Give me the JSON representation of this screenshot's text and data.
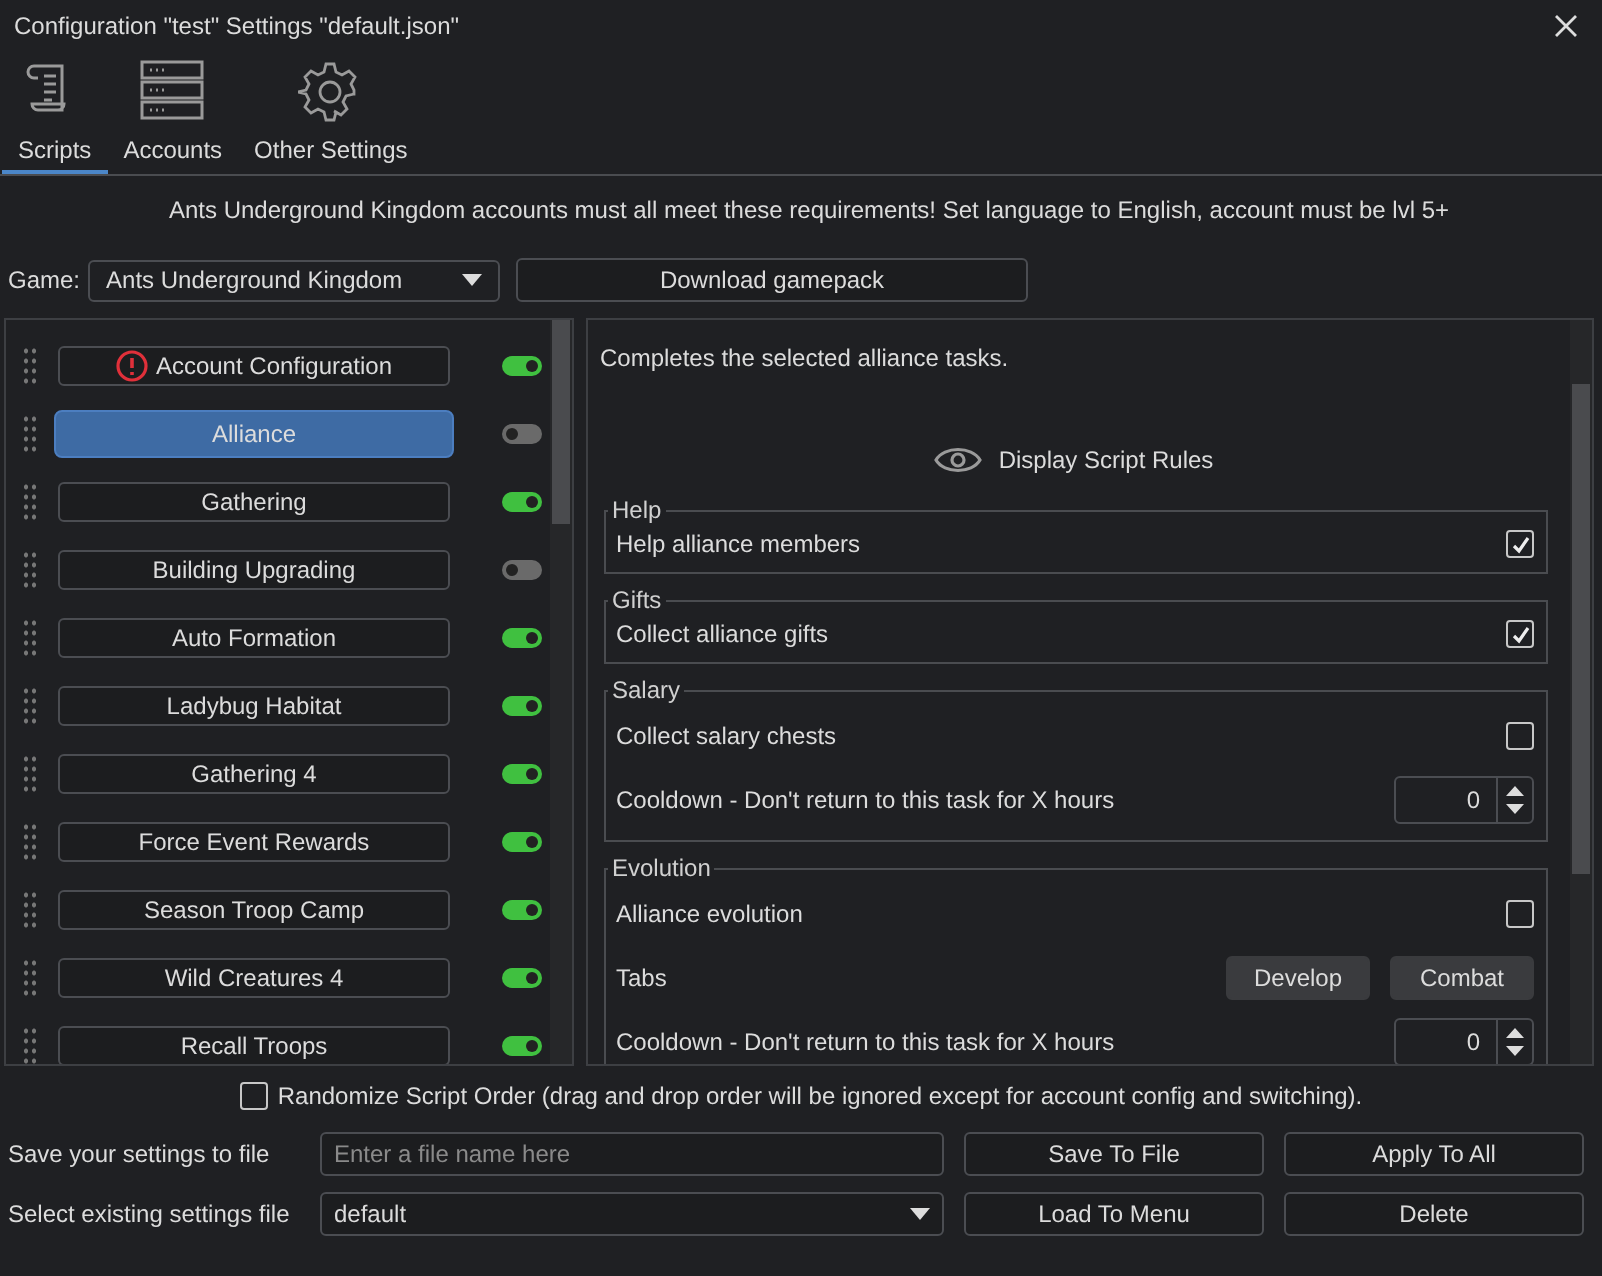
{
  "window": {
    "title": "Configuration \"test\" Settings \"default.json\""
  },
  "tabs": [
    {
      "label": "Scripts",
      "kind": "scroll",
      "selected": true
    },
    {
      "label": "Accounts",
      "kind": "server",
      "selected": false
    },
    {
      "label": "Other Settings",
      "kind": "gear",
      "selected": false
    }
  ],
  "notice": "Ants Underground Kingdom accounts must all meet these requirements! Set language to English, account must be lvl 5+",
  "game": {
    "label": "Game:",
    "value": "Ants Underground Kingdom"
  },
  "download_button": "Download gamepack",
  "scripts": [
    {
      "label": "Account Configuration",
      "warning": true,
      "selected": false,
      "on": true
    },
    {
      "label": "Alliance",
      "warning": false,
      "selected": true,
      "on": false
    },
    {
      "label": "Gathering",
      "warning": false,
      "selected": false,
      "on": true
    },
    {
      "label": "Building Upgrading",
      "warning": false,
      "selected": false,
      "on": false
    },
    {
      "label": "Auto Formation",
      "warning": false,
      "selected": false,
      "on": true
    },
    {
      "label": "Ladybug Habitat",
      "warning": false,
      "selected": false,
      "on": true
    },
    {
      "label": "Gathering 4",
      "warning": false,
      "selected": false,
      "on": true
    },
    {
      "label": "Force Event Rewards",
      "warning": false,
      "selected": false,
      "on": true
    },
    {
      "label": "Season Troop Camp",
      "warning": false,
      "selected": false,
      "on": true
    },
    {
      "label": "Wild Creatures 4",
      "warning": false,
      "selected": false,
      "on": true
    },
    {
      "label": "Recall Troops",
      "warning": false,
      "selected": false,
      "on": true
    }
  ],
  "details": {
    "description": "Completes the selected alliance tasks.",
    "rules_button": "Display Script Rules",
    "groups": [
      {
        "title": "Help",
        "rows": [
          {
            "kind": "checkbox",
            "label": "Help alliance members",
            "checked": true
          }
        ]
      },
      {
        "title": "Gifts",
        "rows": [
          {
            "kind": "checkbox",
            "label": "Collect alliance gifts",
            "checked": true
          }
        ]
      },
      {
        "title": "Salary",
        "rows": [
          {
            "kind": "checkbox",
            "label": "Collect salary chests",
            "checked": false
          },
          {
            "kind": "spinbox",
            "label": "Cooldown - Don't return to this task for X hours",
            "value": "0"
          }
        ]
      },
      {
        "title": "Evolution",
        "rows": [
          {
            "kind": "checkbox",
            "label": "Alliance evolution",
            "checked": false
          },
          {
            "kind": "buttons",
            "label": "Tabs",
            "buttons": [
              "Develop",
              "Combat"
            ]
          },
          {
            "kind": "spinbox",
            "label": "Cooldown - Don't return to this task for X hours",
            "value": "0"
          }
        ]
      }
    ]
  },
  "footer": {
    "randomize": {
      "label": "Randomize Script Order (drag and drop order will be ignored except for account config and switching).",
      "checked": false
    },
    "save_label": "Save your settings to file",
    "file_placeholder": "Enter a file name here",
    "save_button": "Save To File",
    "apply_button": "Apply To All",
    "select_label": "Select existing settings file",
    "file_value": "default",
    "load_button": "Load To Menu",
    "delete_button": "Delete"
  }
}
